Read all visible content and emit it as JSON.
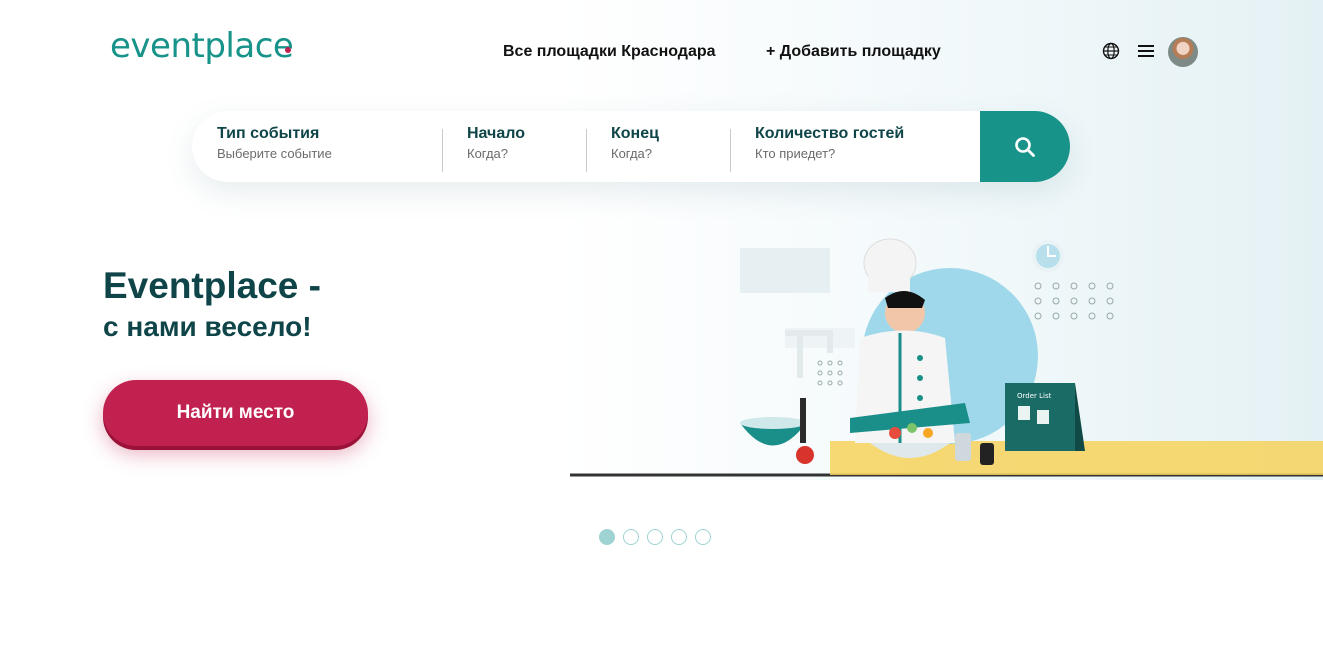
{
  "header": {
    "logo": "eventplace",
    "nav": {
      "all_venues": "Все площадки Краснодара",
      "add_venue": "+ Добавить площадку"
    },
    "icons": [
      "globe-icon",
      "menu-icon",
      "avatar"
    ]
  },
  "search": {
    "event_type": {
      "label": "Тип события",
      "placeholder": "Выберите событие"
    },
    "start": {
      "label": "Начало",
      "placeholder": "Когда?"
    },
    "end": {
      "label": "Конец",
      "placeholder": "Когда?"
    },
    "guests": {
      "label": "Количество гостей",
      "placeholder": "Кто приедет?"
    },
    "button_icon": "search-icon"
  },
  "hero": {
    "title": "Eventplace -",
    "subtitle": "с нами весело!",
    "cta": "Найти место",
    "illustration_text": "Order List"
  },
  "carousel": {
    "count": 5,
    "active": 1
  },
  "colors": {
    "brand": "#17938a",
    "accent": "#c0214f",
    "heading": "#0f4548"
  }
}
